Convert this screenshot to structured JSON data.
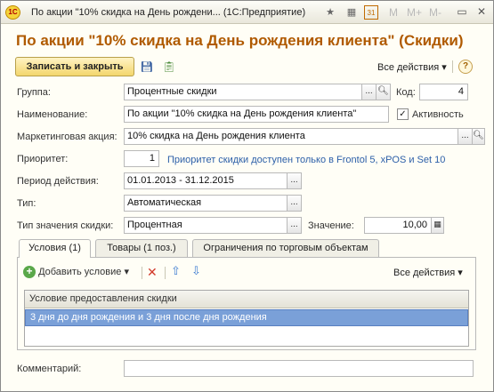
{
  "window": {
    "title": "По акции \"10% скидка на День рождени...  (1С:Предприятие)",
    "logo_text": "1С",
    "toolbar_letters": [
      "M",
      "M+",
      "M-"
    ],
    "calendar_day": "31"
  },
  "form": {
    "title": "По акции \"10% скидка на День рождения клиента\" (Скидки)",
    "save_close_label": "Записать и закрыть",
    "all_actions_label": "Все действия",
    "help_label": "?"
  },
  "fields": {
    "group": {
      "label": "Группа:",
      "value": "Процентные скидки"
    },
    "code": {
      "label": "Код:",
      "value": "4"
    },
    "name": {
      "label": "Наименование:",
      "value": "По акции \"10% скидка на День рождения клиента\""
    },
    "active": {
      "label": "Активность",
      "checked": true
    },
    "promotion": {
      "label": "Маркетинговая акция:",
      "value": "10% скидка на День рождения клиента"
    },
    "priority": {
      "label": "Приоритет:",
      "value": "1",
      "hint": "Приоритет скидки доступен только в Frontol 5, xPOS и Set 10"
    },
    "period": {
      "label": "Период действия:",
      "value": "01.01.2013 - 31.12.2015"
    },
    "type": {
      "label": "Тип:",
      "value": "Автоматическая"
    },
    "value_type": {
      "label": "Тип значения скидки:",
      "value": "Процентная"
    },
    "amount": {
      "label": "Значение:",
      "value": "10,00"
    },
    "comment": {
      "label": "Комментарий:",
      "value": ""
    }
  },
  "tabs": [
    {
      "label": "Условия (1)",
      "active": true
    },
    {
      "label": "Товары (1 поз.)",
      "active": false
    },
    {
      "label": "Ограничения по торговым объектам",
      "active": false
    }
  ],
  "conditions": {
    "add_label": "Добавить условие",
    "all_actions_label": "Все действия",
    "column_header": "Условие предоставления скидки",
    "rows": [
      "3 дня до дня рождения  и 3 дня после дня рождения"
    ]
  },
  "colors": {
    "title": "#b05a00",
    "link": "#2c5fa8",
    "selected_row": "#7aa0d8",
    "primary_button": "#f3d66d"
  }
}
